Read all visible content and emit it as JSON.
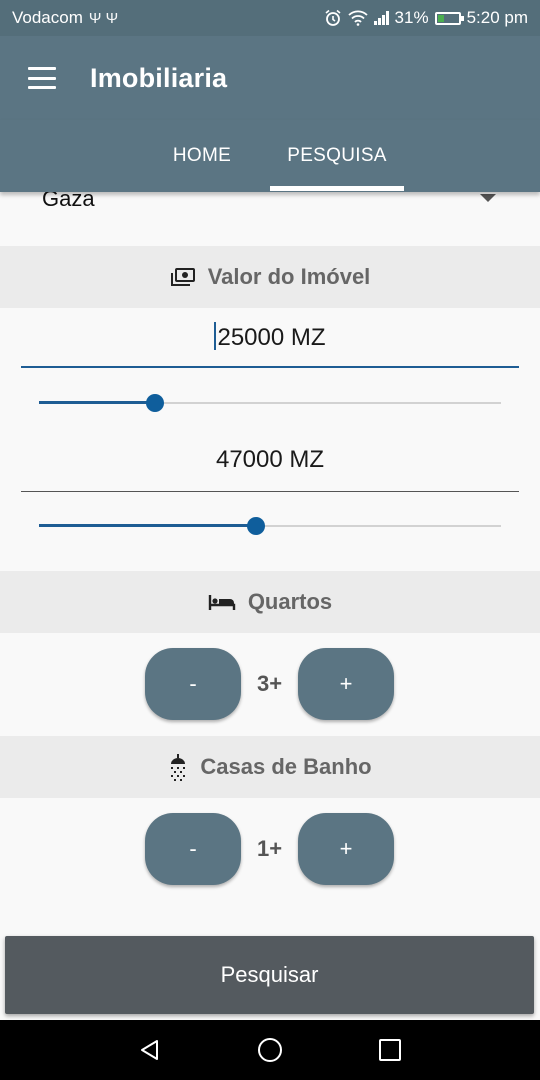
{
  "status_bar": {
    "carrier": "Vodacom",
    "usb_glyphs": "Ψ Ψ",
    "battery": "31%",
    "battery_level": 0.31,
    "time": "5:20 pm",
    "icons": [
      "usb-icon",
      "alarm-icon",
      "wifi-icon",
      "signal-icon",
      "battery-icon"
    ]
  },
  "app_bar": {
    "title": "Imobiliaria",
    "menu_icon": "hamburger-menu-icon"
  },
  "tabs": [
    {
      "label": "HOME",
      "active": false
    },
    {
      "label": "PESQUISA",
      "active": true
    }
  ],
  "location": {
    "selected": "Gaza"
  },
  "valor": {
    "header": "Valor do Imóvel",
    "icon": "money-icon",
    "min_value": "25000 MZ",
    "max_value": "47000 MZ",
    "min_slider_fraction": 0.25,
    "max_slider_fraction": 0.47
  },
  "quartos": {
    "header": "Quartos",
    "icon": "bed-icon",
    "minus_label": "-",
    "value": "3+",
    "plus_label": "+"
  },
  "banho": {
    "header": "Casas de Banho",
    "icon": "shower-icon",
    "minus_label": "-",
    "value": "1+",
    "plus_label": "+"
  },
  "search_button": {
    "label": "Pesquisar"
  },
  "colors": {
    "app_bar": "#5b7583",
    "accent": "#1e5d94",
    "button": "#545a5f"
  }
}
